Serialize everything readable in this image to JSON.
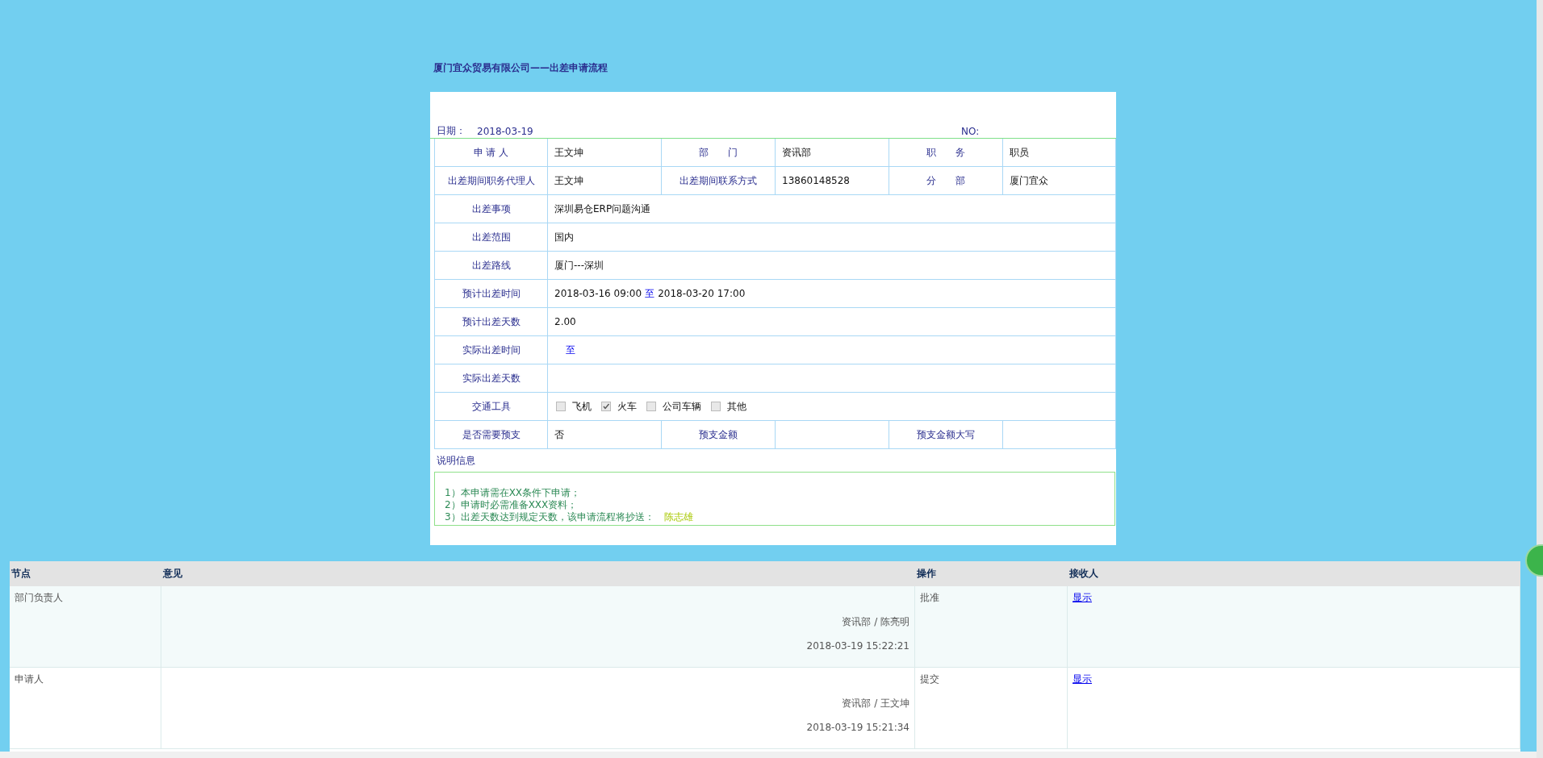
{
  "title": "厦门宜众贸易有限公司——出差申请流程",
  "header": {
    "date_label": "日期：",
    "date": "2018-03-19",
    "no_label": "NO:"
  },
  "form_rows": [
    {
      "kind": "triple",
      "cells": [
        {
          "label": "申 请 人",
          "value": "王文坤"
        },
        {
          "label": "部　　门",
          "value": "资讯部"
        },
        {
          "label": "职　　务",
          "value": "职员"
        }
      ]
    },
    {
      "kind": "triple",
      "cells": [
        {
          "label": "出差期间职务代理人",
          "value": "王文坤"
        },
        {
          "label": "出差期间联系方式",
          "value": "13860148528"
        },
        {
          "label": "分　　部",
          "value": "厦门宜众"
        }
      ]
    },
    {
      "kind": "wide",
      "label": "出差事项",
      "value": "深圳易仓ERP问题沟通"
    },
    {
      "kind": "wide",
      "label": "出差范围",
      "value": "国内"
    },
    {
      "kind": "wide",
      "label": "出差路线",
      "value": "厦门---深圳"
    },
    {
      "kind": "range",
      "label": "预计出差时间",
      "from": "2018-03-16  09:00",
      "to_word": "至",
      "to": "2018-03-20  17:00"
    },
    {
      "kind": "wide",
      "label": "预计出差天数",
      "value": "2.00"
    },
    {
      "kind": "range",
      "label": "实际出差时间",
      "to_word": "至"
    },
    {
      "kind": "wide",
      "label": "实际出差天数"
    },
    {
      "kind": "checks",
      "label": "交通工具",
      "options": [
        {
          "label": "飞机",
          "checked": false
        },
        {
          "label": "火车",
          "checked": true
        },
        {
          "label": "公司车辆",
          "checked": false
        },
        {
          "label": "其他",
          "checked": false
        }
      ]
    },
    {
      "kind": "triple",
      "cells": [
        {
          "label": "是否需要预支",
          "value": "否"
        },
        {
          "label": "预支金额"
        },
        {
          "label": "预支金额大写"
        }
      ]
    }
  ],
  "notes": {
    "label": "说明信息",
    "lines": [
      "1）本申请需在XX条件下申请；",
      "2）申请时必需准备XXX资料；",
      "3）出差天数达到规定天数，该申请流程将抄送："
    ],
    "cc": "陈志雄"
  },
  "flow": {
    "columns": [
      "节点",
      "意见",
      "操作",
      "接收人"
    ],
    "rows": [
      {
        "node": "部门负责人",
        "signer": "资讯部 / 陈亮明",
        "time": "2018-03-19  15:22:21",
        "action": "批准",
        "link": "显示"
      },
      {
        "node": "申请人",
        "signer": "资讯部 / 王文坤",
        "time": "2018-03-19  15:21:34",
        "action": "提交",
        "link": "显示"
      }
    ]
  }
}
